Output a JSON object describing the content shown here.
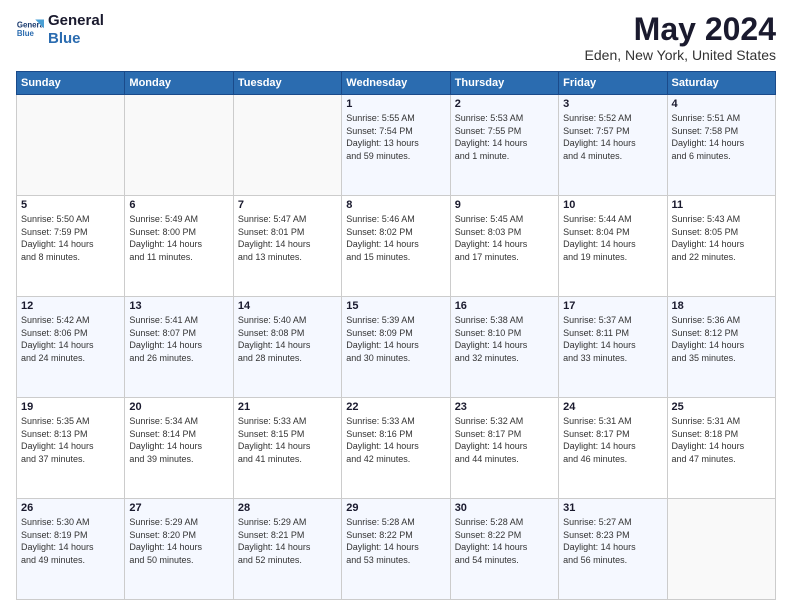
{
  "header": {
    "logo": {
      "line1": "General",
      "line2": "Blue"
    },
    "title": "May 2024",
    "subtitle": "Eden, New York, United States"
  },
  "weekdays": [
    "Sunday",
    "Monday",
    "Tuesday",
    "Wednesday",
    "Thursday",
    "Friday",
    "Saturday"
  ],
  "weeks": [
    [
      {
        "day": "",
        "info": ""
      },
      {
        "day": "",
        "info": ""
      },
      {
        "day": "",
        "info": ""
      },
      {
        "day": "1",
        "info": "Sunrise: 5:55 AM\nSunset: 7:54 PM\nDaylight: 13 hours\nand 59 minutes."
      },
      {
        "day": "2",
        "info": "Sunrise: 5:53 AM\nSunset: 7:55 PM\nDaylight: 14 hours\nand 1 minute."
      },
      {
        "day": "3",
        "info": "Sunrise: 5:52 AM\nSunset: 7:57 PM\nDaylight: 14 hours\nand 4 minutes."
      },
      {
        "day": "4",
        "info": "Sunrise: 5:51 AM\nSunset: 7:58 PM\nDaylight: 14 hours\nand 6 minutes."
      }
    ],
    [
      {
        "day": "5",
        "info": "Sunrise: 5:50 AM\nSunset: 7:59 PM\nDaylight: 14 hours\nand 8 minutes."
      },
      {
        "day": "6",
        "info": "Sunrise: 5:49 AM\nSunset: 8:00 PM\nDaylight: 14 hours\nand 11 minutes."
      },
      {
        "day": "7",
        "info": "Sunrise: 5:47 AM\nSunset: 8:01 PM\nDaylight: 14 hours\nand 13 minutes."
      },
      {
        "day": "8",
        "info": "Sunrise: 5:46 AM\nSunset: 8:02 PM\nDaylight: 14 hours\nand 15 minutes."
      },
      {
        "day": "9",
        "info": "Sunrise: 5:45 AM\nSunset: 8:03 PM\nDaylight: 14 hours\nand 17 minutes."
      },
      {
        "day": "10",
        "info": "Sunrise: 5:44 AM\nSunset: 8:04 PM\nDaylight: 14 hours\nand 19 minutes."
      },
      {
        "day": "11",
        "info": "Sunrise: 5:43 AM\nSunset: 8:05 PM\nDaylight: 14 hours\nand 22 minutes."
      }
    ],
    [
      {
        "day": "12",
        "info": "Sunrise: 5:42 AM\nSunset: 8:06 PM\nDaylight: 14 hours\nand 24 minutes."
      },
      {
        "day": "13",
        "info": "Sunrise: 5:41 AM\nSunset: 8:07 PM\nDaylight: 14 hours\nand 26 minutes."
      },
      {
        "day": "14",
        "info": "Sunrise: 5:40 AM\nSunset: 8:08 PM\nDaylight: 14 hours\nand 28 minutes."
      },
      {
        "day": "15",
        "info": "Sunrise: 5:39 AM\nSunset: 8:09 PM\nDaylight: 14 hours\nand 30 minutes."
      },
      {
        "day": "16",
        "info": "Sunrise: 5:38 AM\nSunset: 8:10 PM\nDaylight: 14 hours\nand 32 minutes."
      },
      {
        "day": "17",
        "info": "Sunrise: 5:37 AM\nSunset: 8:11 PM\nDaylight: 14 hours\nand 33 minutes."
      },
      {
        "day": "18",
        "info": "Sunrise: 5:36 AM\nSunset: 8:12 PM\nDaylight: 14 hours\nand 35 minutes."
      }
    ],
    [
      {
        "day": "19",
        "info": "Sunrise: 5:35 AM\nSunset: 8:13 PM\nDaylight: 14 hours\nand 37 minutes."
      },
      {
        "day": "20",
        "info": "Sunrise: 5:34 AM\nSunset: 8:14 PM\nDaylight: 14 hours\nand 39 minutes."
      },
      {
        "day": "21",
        "info": "Sunrise: 5:33 AM\nSunset: 8:15 PM\nDaylight: 14 hours\nand 41 minutes."
      },
      {
        "day": "22",
        "info": "Sunrise: 5:33 AM\nSunset: 8:16 PM\nDaylight: 14 hours\nand 42 minutes."
      },
      {
        "day": "23",
        "info": "Sunrise: 5:32 AM\nSunset: 8:17 PM\nDaylight: 14 hours\nand 44 minutes."
      },
      {
        "day": "24",
        "info": "Sunrise: 5:31 AM\nSunset: 8:17 PM\nDaylight: 14 hours\nand 46 minutes."
      },
      {
        "day": "25",
        "info": "Sunrise: 5:31 AM\nSunset: 8:18 PM\nDaylight: 14 hours\nand 47 minutes."
      }
    ],
    [
      {
        "day": "26",
        "info": "Sunrise: 5:30 AM\nSunset: 8:19 PM\nDaylight: 14 hours\nand 49 minutes."
      },
      {
        "day": "27",
        "info": "Sunrise: 5:29 AM\nSunset: 8:20 PM\nDaylight: 14 hours\nand 50 minutes."
      },
      {
        "day": "28",
        "info": "Sunrise: 5:29 AM\nSunset: 8:21 PM\nDaylight: 14 hours\nand 52 minutes."
      },
      {
        "day": "29",
        "info": "Sunrise: 5:28 AM\nSunset: 8:22 PM\nDaylight: 14 hours\nand 53 minutes."
      },
      {
        "day": "30",
        "info": "Sunrise: 5:28 AM\nSunset: 8:22 PM\nDaylight: 14 hours\nand 54 minutes."
      },
      {
        "day": "31",
        "info": "Sunrise: 5:27 AM\nSunset: 8:23 PM\nDaylight: 14 hours\nand 56 minutes."
      },
      {
        "day": "",
        "info": ""
      }
    ]
  ]
}
